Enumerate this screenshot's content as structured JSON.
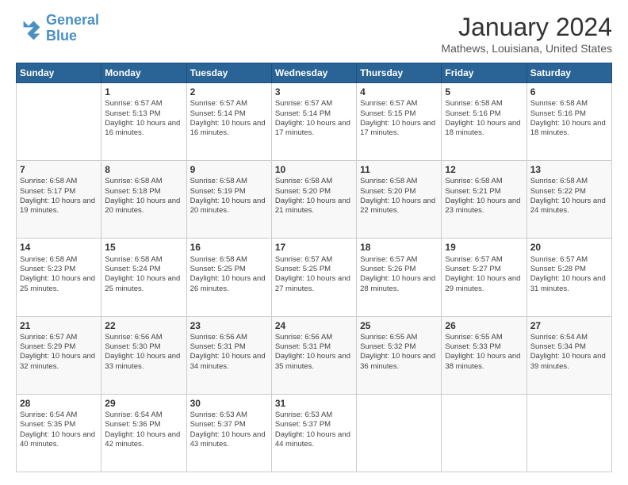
{
  "header": {
    "logo_general": "General",
    "logo_blue": "Blue",
    "month_title": "January 2024",
    "location": "Mathews, Louisiana, United States"
  },
  "days_of_week": [
    "Sunday",
    "Monday",
    "Tuesday",
    "Wednesday",
    "Thursday",
    "Friday",
    "Saturday"
  ],
  "weeks": [
    [
      {
        "day": "",
        "content": ""
      },
      {
        "day": "1",
        "content": "Sunrise: 6:57 AM\nSunset: 5:13 PM\nDaylight: 10 hours\nand 16 minutes."
      },
      {
        "day": "2",
        "content": "Sunrise: 6:57 AM\nSunset: 5:14 PM\nDaylight: 10 hours\nand 16 minutes."
      },
      {
        "day": "3",
        "content": "Sunrise: 6:57 AM\nSunset: 5:14 PM\nDaylight: 10 hours\nand 17 minutes."
      },
      {
        "day": "4",
        "content": "Sunrise: 6:57 AM\nSunset: 5:15 PM\nDaylight: 10 hours\nand 17 minutes."
      },
      {
        "day": "5",
        "content": "Sunrise: 6:58 AM\nSunset: 5:16 PM\nDaylight: 10 hours\nand 18 minutes."
      },
      {
        "day": "6",
        "content": "Sunrise: 6:58 AM\nSunset: 5:16 PM\nDaylight: 10 hours\nand 18 minutes."
      }
    ],
    [
      {
        "day": "7",
        "content": "Sunrise: 6:58 AM\nSunset: 5:17 PM\nDaylight: 10 hours\nand 19 minutes."
      },
      {
        "day": "8",
        "content": "Sunrise: 6:58 AM\nSunset: 5:18 PM\nDaylight: 10 hours\nand 20 minutes."
      },
      {
        "day": "9",
        "content": "Sunrise: 6:58 AM\nSunset: 5:19 PM\nDaylight: 10 hours\nand 20 minutes."
      },
      {
        "day": "10",
        "content": "Sunrise: 6:58 AM\nSunset: 5:20 PM\nDaylight: 10 hours\nand 21 minutes."
      },
      {
        "day": "11",
        "content": "Sunrise: 6:58 AM\nSunset: 5:20 PM\nDaylight: 10 hours\nand 22 minutes."
      },
      {
        "day": "12",
        "content": "Sunrise: 6:58 AM\nSunset: 5:21 PM\nDaylight: 10 hours\nand 23 minutes."
      },
      {
        "day": "13",
        "content": "Sunrise: 6:58 AM\nSunset: 5:22 PM\nDaylight: 10 hours\nand 24 minutes."
      }
    ],
    [
      {
        "day": "14",
        "content": "Sunrise: 6:58 AM\nSunset: 5:23 PM\nDaylight: 10 hours\nand 25 minutes."
      },
      {
        "day": "15",
        "content": "Sunrise: 6:58 AM\nSunset: 5:24 PM\nDaylight: 10 hours\nand 25 minutes."
      },
      {
        "day": "16",
        "content": "Sunrise: 6:58 AM\nSunset: 5:25 PM\nDaylight: 10 hours\nand 26 minutes."
      },
      {
        "day": "17",
        "content": "Sunrise: 6:57 AM\nSunset: 5:25 PM\nDaylight: 10 hours\nand 27 minutes."
      },
      {
        "day": "18",
        "content": "Sunrise: 6:57 AM\nSunset: 5:26 PM\nDaylight: 10 hours\nand 28 minutes."
      },
      {
        "day": "19",
        "content": "Sunrise: 6:57 AM\nSunset: 5:27 PM\nDaylight: 10 hours\nand 29 minutes."
      },
      {
        "day": "20",
        "content": "Sunrise: 6:57 AM\nSunset: 5:28 PM\nDaylight: 10 hours\nand 31 minutes."
      }
    ],
    [
      {
        "day": "21",
        "content": "Sunrise: 6:57 AM\nSunset: 5:29 PM\nDaylight: 10 hours\nand 32 minutes."
      },
      {
        "day": "22",
        "content": "Sunrise: 6:56 AM\nSunset: 5:30 PM\nDaylight: 10 hours\nand 33 minutes."
      },
      {
        "day": "23",
        "content": "Sunrise: 6:56 AM\nSunset: 5:31 PM\nDaylight: 10 hours\nand 34 minutes."
      },
      {
        "day": "24",
        "content": "Sunrise: 6:56 AM\nSunset: 5:31 PM\nDaylight: 10 hours\nand 35 minutes."
      },
      {
        "day": "25",
        "content": "Sunrise: 6:55 AM\nSunset: 5:32 PM\nDaylight: 10 hours\nand 36 minutes."
      },
      {
        "day": "26",
        "content": "Sunrise: 6:55 AM\nSunset: 5:33 PM\nDaylight: 10 hours\nand 38 minutes."
      },
      {
        "day": "27",
        "content": "Sunrise: 6:54 AM\nSunset: 5:34 PM\nDaylight: 10 hours\nand 39 minutes."
      }
    ],
    [
      {
        "day": "28",
        "content": "Sunrise: 6:54 AM\nSunset: 5:35 PM\nDaylight: 10 hours\nand 40 minutes."
      },
      {
        "day": "29",
        "content": "Sunrise: 6:54 AM\nSunset: 5:36 PM\nDaylight: 10 hours\nand 42 minutes."
      },
      {
        "day": "30",
        "content": "Sunrise: 6:53 AM\nSunset: 5:37 PM\nDaylight: 10 hours\nand 43 minutes."
      },
      {
        "day": "31",
        "content": "Sunrise: 6:53 AM\nSunset: 5:37 PM\nDaylight: 10 hours\nand 44 minutes."
      },
      {
        "day": "",
        "content": ""
      },
      {
        "day": "",
        "content": ""
      },
      {
        "day": "",
        "content": ""
      }
    ]
  ]
}
